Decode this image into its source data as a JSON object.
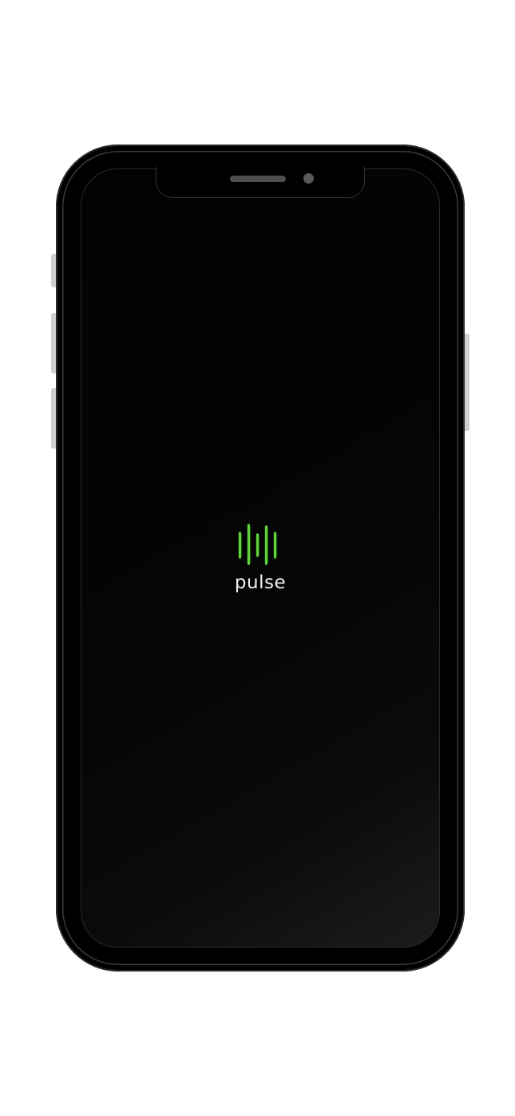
{
  "app": {
    "name": "pulse"
  },
  "icons": {
    "logo": "waveform-bars-icon"
  },
  "colors": {
    "screen_background": "#050505",
    "logo_accent": "#5fd13b",
    "logo_text": "#f2f2f2",
    "page_background": "#ffffff"
  }
}
